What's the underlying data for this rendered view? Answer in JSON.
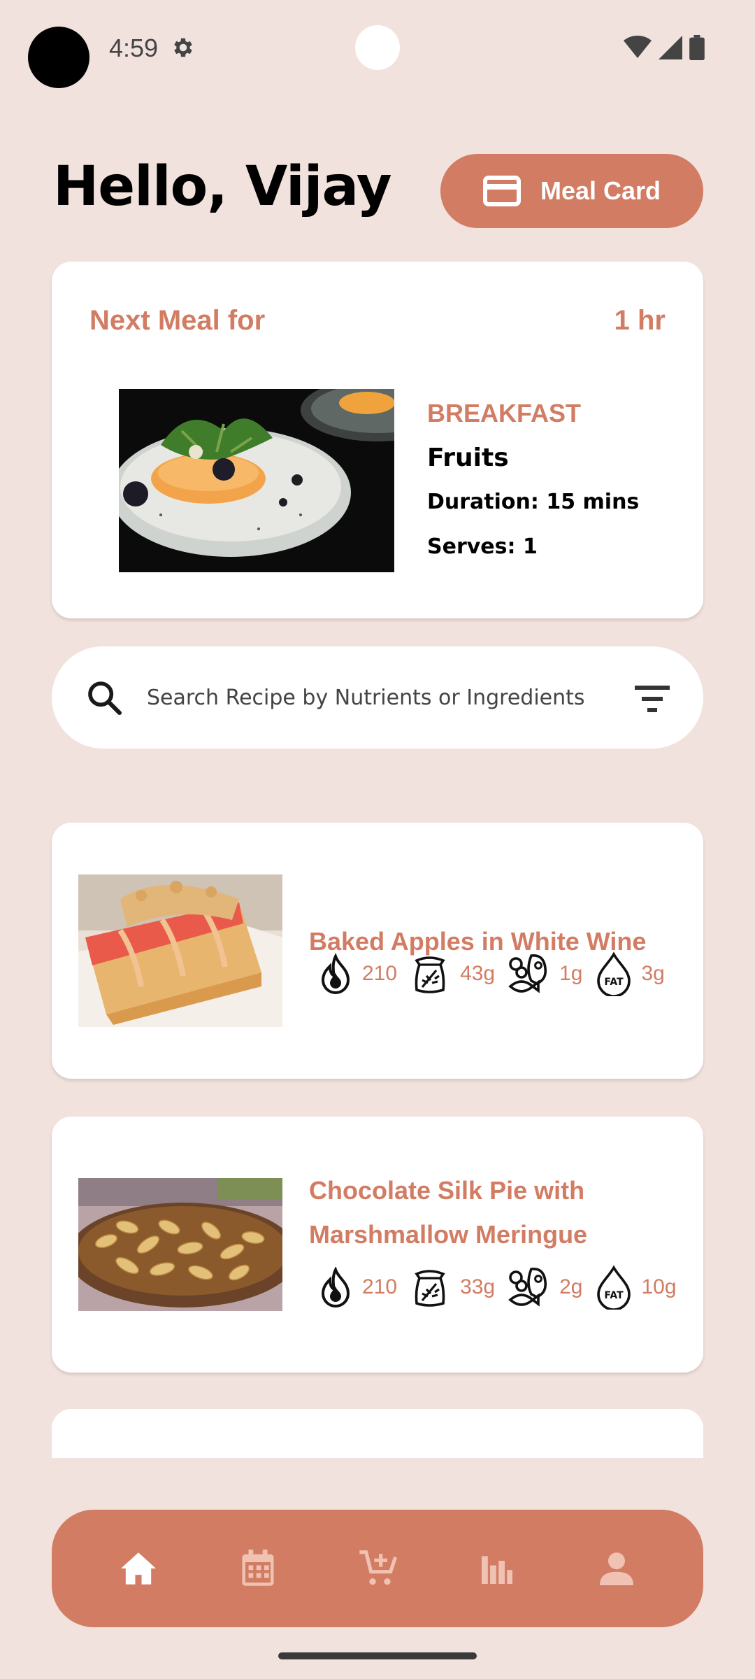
{
  "status_bar": {
    "time": "4:59"
  },
  "header": {
    "greeting": "Hello, Vijay",
    "meal_card_label": "Meal Card"
  },
  "next_meal": {
    "title": "Next Meal for",
    "time": "1 hr",
    "type": "BREAKFAST",
    "name": "Fruits",
    "duration": "Duration: 15 mins",
    "serves": "Serves: 1"
  },
  "search": {
    "placeholder": "Search Recipe by Nutrients or Ingredients"
  },
  "recipes": [
    {
      "title": "Baked Apples in White Wine",
      "calories": "210",
      "carbs": "43g",
      "protein": "1g",
      "fat": "3g"
    },
    {
      "title": "Chocolate Silk Pie with Marshmallow Meringue",
      "calories": "210",
      "carbs": "33g",
      "protein": "2g",
      "fat": "10g"
    }
  ],
  "nav": {
    "active": "home",
    "items": [
      "home-icon",
      "calendar-icon",
      "cart-icon",
      "stats-icon",
      "profile-icon"
    ]
  },
  "colors": {
    "accent": "#D27C63",
    "background": "#F2E2DD",
    "card": "#FFFFFF"
  }
}
